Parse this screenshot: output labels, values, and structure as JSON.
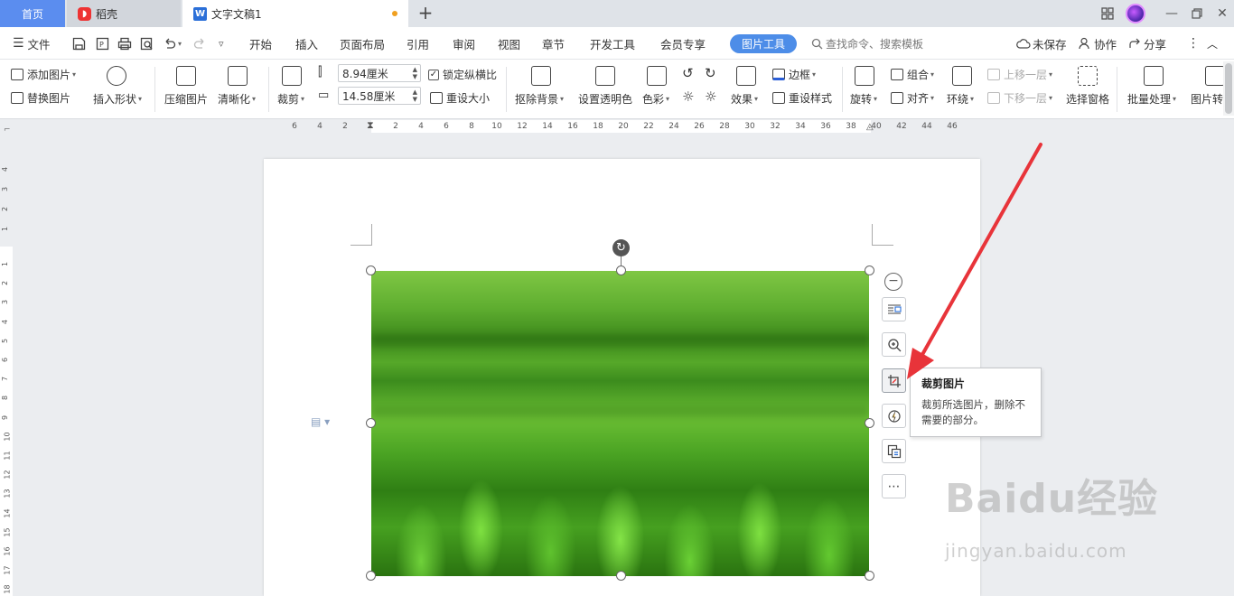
{
  "tabs": {
    "home": "首页",
    "daoke": "稻壳",
    "doc": "文字文稿1"
  },
  "menubar": {
    "file": "文件",
    "items": [
      "开始",
      "插入",
      "页面布局",
      "引用",
      "审阅",
      "视图",
      "章节",
      "开发工具",
      "会员专享"
    ],
    "active": "图片工具",
    "search_placeholder": "查找命令、搜索模板",
    "unsaved": "未保存",
    "collab": "协作",
    "share": "分享"
  },
  "ribbon": {
    "add_picture": "添加图片",
    "replace_picture": "替换图片",
    "insert_shape": "插入形状",
    "compress": "压缩图片",
    "sharpen": "清晰化",
    "crop": "裁剪",
    "height_value": "8.94厘米",
    "width_value": "14.58厘米",
    "lock_ratio": "锁定纵横比",
    "reset_size": "重设大小",
    "remove_bg": "抠除背景",
    "set_transparent": "设置透明色",
    "color": "色彩",
    "effect": "效果",
    "border": "边框",
    "reset_style": "重设样式",
    "rotate": "旋转",
    "group": "组合",
    "align": "对齐",
    "wrap": "环绕",
    "bring_forward": "上移一层",
    "send_backward": "下移一层",
    "selection_pane": "选择窗格",
    "batch": "批量处理",
    "picture_convert": "图片转"
  },
  "hruler_ticks": [
    "6",
    "4",
    "2",
    "2",
    "4",
    "6",
    "8",
    "10",
    "12",
    "14",
    "16",
    "18",
    "20",
    "22",
    "24",
    "26",
    "28",
    "30",
    "32",
    "34",
    "36",
    "38",
    "40",
    "42",
    "44",
    "46"
  ],
  "vruler_ticks": [
    "4",
    "3",
    "2",
    "1",
    "1",
    "2",
    "3",
    "4",
    "5",
    "6",
    "7",
    "8",
    "9",
    "10",
    "11",
    "12",
    "13",
    "14",
    "15",
    "16",
    "17",
    "18"
  ],
  "tooltip": {
    "title": "裁剪图片",
    "desc_line1": "裁剪所选图片，删除不",
    "desc_line2": "需要的部分。"
  },
  "watermark": {
    "brand": "Baidu经验",
    "url": "jingyan.baidu.com"
  },
  "colors": {
    "accent": "#4d8de8",
    "arrow": "#e8343a"
  }
}
